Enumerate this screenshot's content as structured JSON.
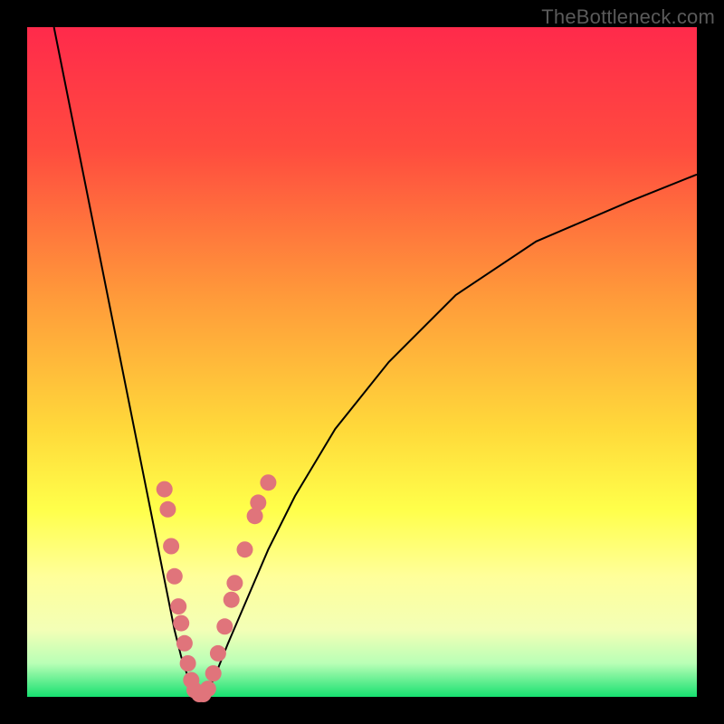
{
  "watermark": "TheBottleneck.com",
  "colors": {
    "frame": "#000000",
    "curve_stroke": "#000000",
    "dot_fill": "#e0747b",
    "gradient_stops": [
      {
        "pct": 0,
        "color": "#ff2a4b"
      },
      {
        "pct": 18,
        "color": "#ff4b3f"
      },
      {
        "pct": 40,
        "color": "#ff993a"
      },
      {
        "pct": 60,
        "color": "#ffd93a"
      },
      {
        "pct": 72,
        "color": "#ffff4a"
      },
      {
        "pct": 82,
        "color": "#ffff9a"
      },
      {
        "pct": 90,
        "color": "#f3ffb6"
      },
      {
        "pct": 95,
        "color": "#b9ffb6"
      },
      {
        "pct": 100,
        "color": "#17e070"
      }
    ]
  },
  "chart_data": {
    "type": "line",
    "title": "",
    "xlabel": "",
    "ylabel": "",
    "xlim": [
      0,
      100
    ],
    "ylim": [
      0,
      100
    ],
    "series": [
      {
        "name": "left-curve",
        "x": [
          4,
          6,
          8,
          10,
          12,
          14,
          16,
          18,
          20,
          22,
          23,
          24,
          25,
          26
        ],
        "y": [
          100,
          90,
          80,
          70,
          60,
          50,
          40,
          30,
          20,
          10,
          6,
          3,
          1,
          0
        ]
      },
      {
        "name": "right-curve",
        "x": [
          26,
          27,
          28,
          30,
          33,
          36,
          40,
          46,
          54,
          64,
          76,
          90,
          100
        ],
        "y": [
          0,
          1,
          3,
          8,
          15,
          22,
          30,
          40,
          50,
          60,
          68,
          74,
          78
        ]
      }
    ],
    "dots": [
      {
        "x": 20.5,
        "y": 31.0
      },
      {
        "x": 21.0,
        "y": 28.0
      },
      {
        "x": 21.5,
        "y": 22.5
      },
      {
        "x": 22.0,
        "y": 18.0
      },
      {
        "x": 22.6,
        "y": 13.5
      },
      {
        "x": 23.0,
        "y": 11.0
      },
      {
        "x": 23.5,
        "y": 8.0
      },
      {
        "x": 24.0,
        "y": 5.0
      },
      {
        "x": 24.5,
        "y": 2.5
      },
      {
        "x": 25.0,
        "y": 1.0
      },
      {
        "x": 25.7,
        "y": 0.4
      },
      {
        "x": 26.3,
        "y": 0.4
      },
      {
        "x": 27.0,
        "y": 1.2
      },
      {
        "x": 27.8,
        "y": 3.5
      },
      {
        "x": 28.5,
        "y": 6.5
      },
      {
        "x": 29.5,
        "y": 10.5
      },
      {
        "x": 30.5,
        "y": 14.5
      },
      {
        "x": 31.0,
        "y": 17.0
      },
      {
        "x": 32.5,
        "y": 22.0
      },
      {
        "x": 34.0,
        "y": 27.0
      },
      {
        "x": 34.5,
        "y": 29.0
      },
      {
        "x": 36.0,
        "y": 32.0
      }
    ]
  }
}
